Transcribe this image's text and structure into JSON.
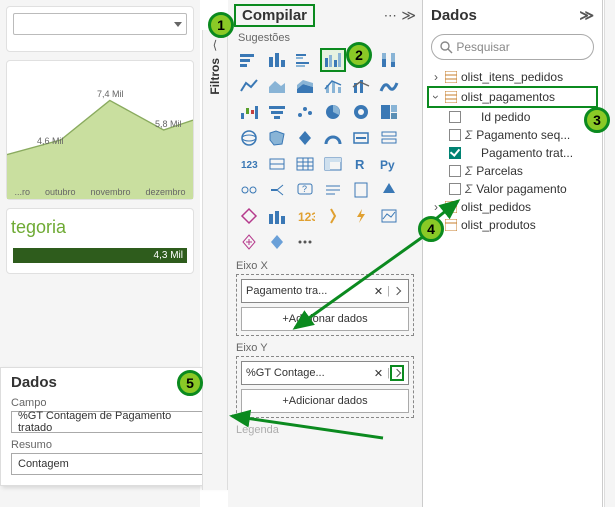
{
  "workspace": {
    "axis_months": [
      "...ro",
      "outubro",
      "novembro",
      "dezembro"
    ],
    "datalabels": [
      "4,6 Mil",
      "7,4 Mil",
      "5,8 Mil"
    ],
    "card_title": "tegoria",
    "bar_value": "4,3 Mil"
  },
  "bottom_panel": {
    "title": "Dados",
    "field_label": "Campo",
    "field_value": "%GT Contagem de Pagamento tratado",
    "summary_label": "Resumo",
    "summary_value": "Contagem"
  },
  "filters_rail": {
    "label": "Filtros"
  },
  "compile": {
    "title": "Compilar",
    "suggestions": "Sugestões",
    "axis_x": {
      "label": "Eixo X",
      "value": "Pagamento tra...",
      "add": "+Adicionar dados"
    },
    "axis_y": {
      "label": "Eixo Y",
      "value": "%GT Contage...",
      "add": "+Adicionar dados"
    },
    "legend_label": "Legenda"
  },
  "data": {
    "title": "Dados",
    "search_placeholder": "Pesquisar",
    "tables": {
      "itens": "olist_itens_pedidos",
      "pagamentos": "olist_pagamentos",
      "pedidos": "olist_pedidos",
      "produtos": "olist_produtos"
    },
    "fields": {
      "id_pedido": "Id pedido",
      "pag_seq": "Pagamento seq...",
      "pag_trat": "Pagamento trat...",
      "parcelas": "Parcelas",
      "valor": "Valor pagamento"
    }
  },
  "steps": {
    "s1": "1",
    "s2": "2",
    "s3": "3",
    "s4": "4",
    "s5": "5"
  },
  "chart_data": {
    "type": "area",
    "categories": [
      "outubro",
      "novembro",
      "dezembro"
    ],
    "values": [
      4.6,
      7.4,
      5.8
    ],
    "unit": "Mil",
    "ylim": [
      0,
      8
    ]
  }
}
